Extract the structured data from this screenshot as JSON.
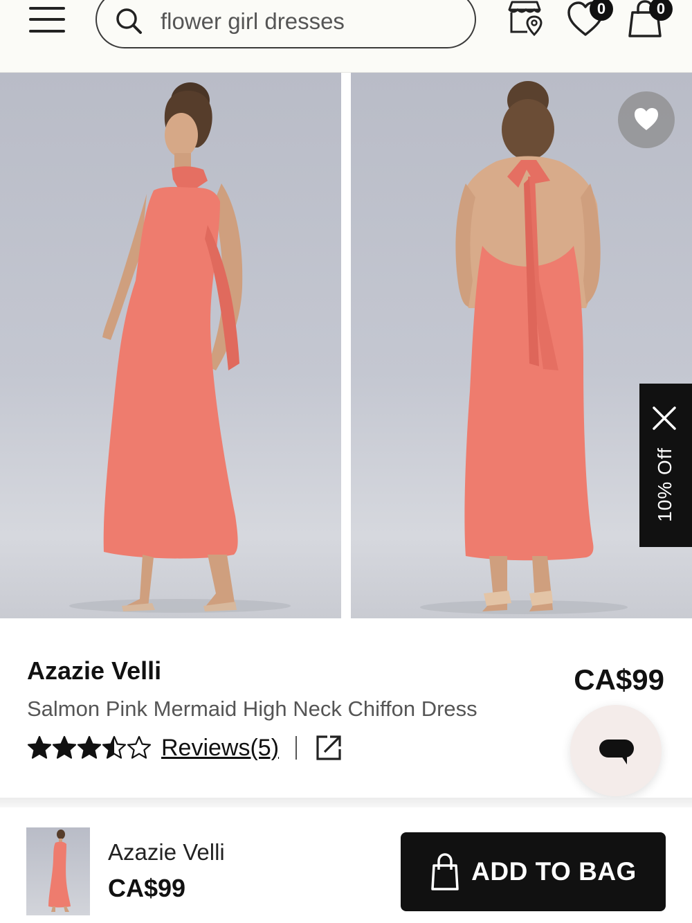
{
  "header": {
    "search_value": "flower girl dresses",
    "favorites_count": "0",
    "bag_count": "0"
  },
  "promo": {
    "label": "10% Off"
  },
  "product": {
    "brand": "Azazie Velli",
    "name": "Salmon Pink Mermaid High Neck Chiffon Dress",
    "price": "CA$99",
    "rating": 3.5,
    "rating_max": 5,
    "reviews_label": "Reviews(5)",
    "dress_color": "#ee7c6e"
  },
  "bottom_bar": {
    "name": "Azazie Velli",
    "price": "CA$99",
    "add_to_bag_label": "ADD TO BAG"
  }
}
